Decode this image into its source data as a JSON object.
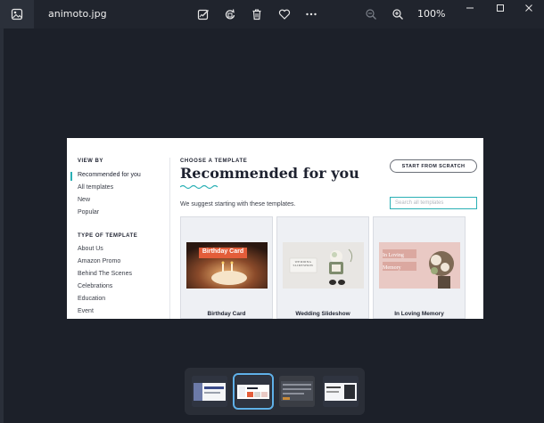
{
  "viewer": {
    "file_name": "animoto.jpg",
    "zoom": "100%",
    "icons": {
      "app": "photo-app-icon",
      "edit": "edit-image-icon",
      "rotate": "rotate-icon",
      "delete": "trash-icon",
      "favorite": "heart-icon",
      "more": "more-icon",
      "zoom_out": "zoom-out-icon",
      "zoom_in": "zoom-in-icon"
    },
    "window_controls": [
      "minimize-icon",
      "maximize-icon",
      "close-icon"
    ]
  },
  "photo": {
    "sidebar": {
      "view_by_heading": "VIEW BY",
      "view_by_items": [
        "Recommended for you",
        "All templates",
        "New",
        "Popular"
      ],
      "type_heading": "TYPE OF TEMPLATE",
      "type_items": [
        "About Us",
        "Amazon Promo",
        "Behind The Scenes",
        "Celebrations",
        "Education",
        "Event"
      ]
    },
    "main": {
      "eyebrow": "CHOOSE A TEMPLATE",
      "title": "Recommended for you",
      "subtitle": "We suggest starting with these templates.",
      "start_button": "START FROM SCRATCH",
      "search_placeholder": "Search all templates",
      "cards": [
        {
          "label": "Birthday Card",
          "thumb_text": "Birthday Card"
        },
        {
          "label": "Wedding Slideshow",
          "thumb_text": "WEDDING\nSLIDESHOW"
        },
        {
          "label": "In Loving Memory",
          "thumb_text": "In Loving Memory"
        }
      ]
    },
    "colors": {
      "accent": "#2ab0b5",
      "dark_text": "#1e2230"
    }
  },
  "filmstrip": {
    "selected_index": 1,
    "count": 4
  }
}
